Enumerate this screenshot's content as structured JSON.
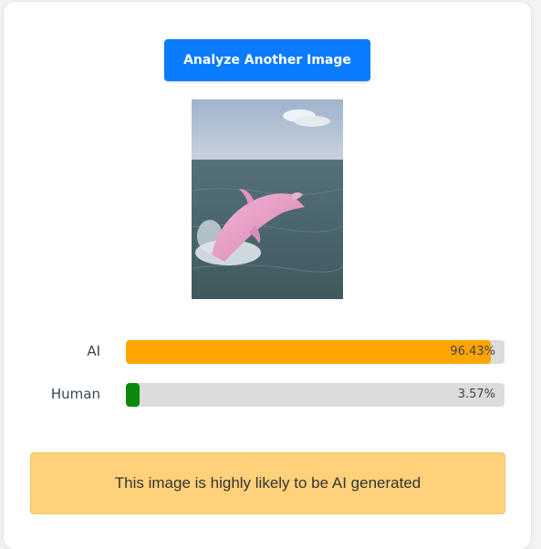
{
  "buttons": {
    "analyze_label": "Analyze Another Image"
  },
  "image": {
    "subject": "pink dolphin leaping from ocean water"
  },
  "results": [
    {
      "label": "AI",
      "value_text": "96.43%",
      "fraction": 0.9643,
      "color": "#ffa500"
    },
    {
      "label": "Human",
      "value_text": "3.57%",
      "fraction": 0.0357,
      "color": "#0a8a0a"
    }
  ],
  "verdict": "This image is highly likely to be AI generated"
}
